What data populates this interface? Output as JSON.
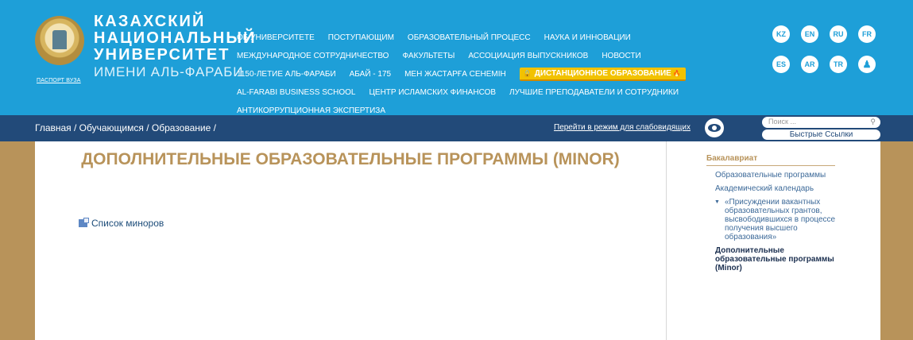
{
  "header": {
    "passport_label": "ПАСПОРТ ВУЗА",
    "university_name": [
      "КАЗАХСКИЙ",
      "НАЦИОНАЛЬНЫЙ",
      "УНИВЕРСИТЕТ",
      "ИМЕНИ АЛЬ-ФАРАБИ"
    ],
    "nav_rows": [
      [
        "ОБ УНИВЕРСИТЕТЕ",
        "ПОСТУПАЮЩИМ",
        "ОБРАЗОВАТЕЛЬНЫЙ ПРОЦЕСС",
        "НАУКА И ИННОВАЦИИ"
      ],
      [
        "МЕЖДУНАРОДНОЕ СОТРУДНИЧЕСТВО",
        "ФАКУЛЬТЕТЫ",
        "АССОЦИАЦИЯ ВЫПУСКНИКОВ",
        "НОВОСТИ"
      ],
      [
        "1150-ЛЕТИЕ АЛЬ-ФАРАБИ",
        "АБАЙ - 175",
        "МЕН ЖАСТАРҒА СЕНЕМІН",
        "ДИСТАНЦИОННОЕ ОБРАЗОВАНИЕ"
      ],
      [
        "AL-FARABI BUSINESS SCHOOL",
        "ЦЕНТР ИСЛАМСКИХ ФИНАНСОВ",
        "ЛУЧШИЕ ПРЕПОДАВАТЕЛИ И СОТРУДНИКИ"
      ],
      [
        "АНТИКОРРУПЦИОННАЯ ЭКСПЕРТИЗА"
      ]
    ],
    "languages": [
      [
        "KZ",
        "EN",
        "RU",
        "FR"
      ],
      [
        "ES",
        "AR",
        "TR"
      ]
    ],
    "accessibility_icon": "accessibility-person-icon",
    "brand_color": "#1e9fd8",
    "highlight_color": "#f2c200"
  },
  "bar": {
    "breadcrumb": "Главная / Обучающимся / Образование /",
    "accessibility_link": "Перейти в режим для слабовидящих",
    "search_placeholder": "Поиск ...",
    "quick_links": "Быстрые Ссылки",
    "bar_color": "#224a79"
  },
  "main": {
    "title": "ДОПОЛНИТЕЛЬНЫЕ ОБРАЗОВАТЕЛЬНЫЕ ПРОГРАММЫ (MINOR)",
    "doc_link": "Список миноров"
  },
  "sidebar": {
    "heading": "Бакалавриат",
    "items": [
      "Образовательные программы",
      "Академический календарь",
      "«Присуждении вакантных образовательных грантов, высвободившихся в процессе получения высшего образования»",
      "Дополнительные образовательные программы (Minor)"
    ]
  }
}
